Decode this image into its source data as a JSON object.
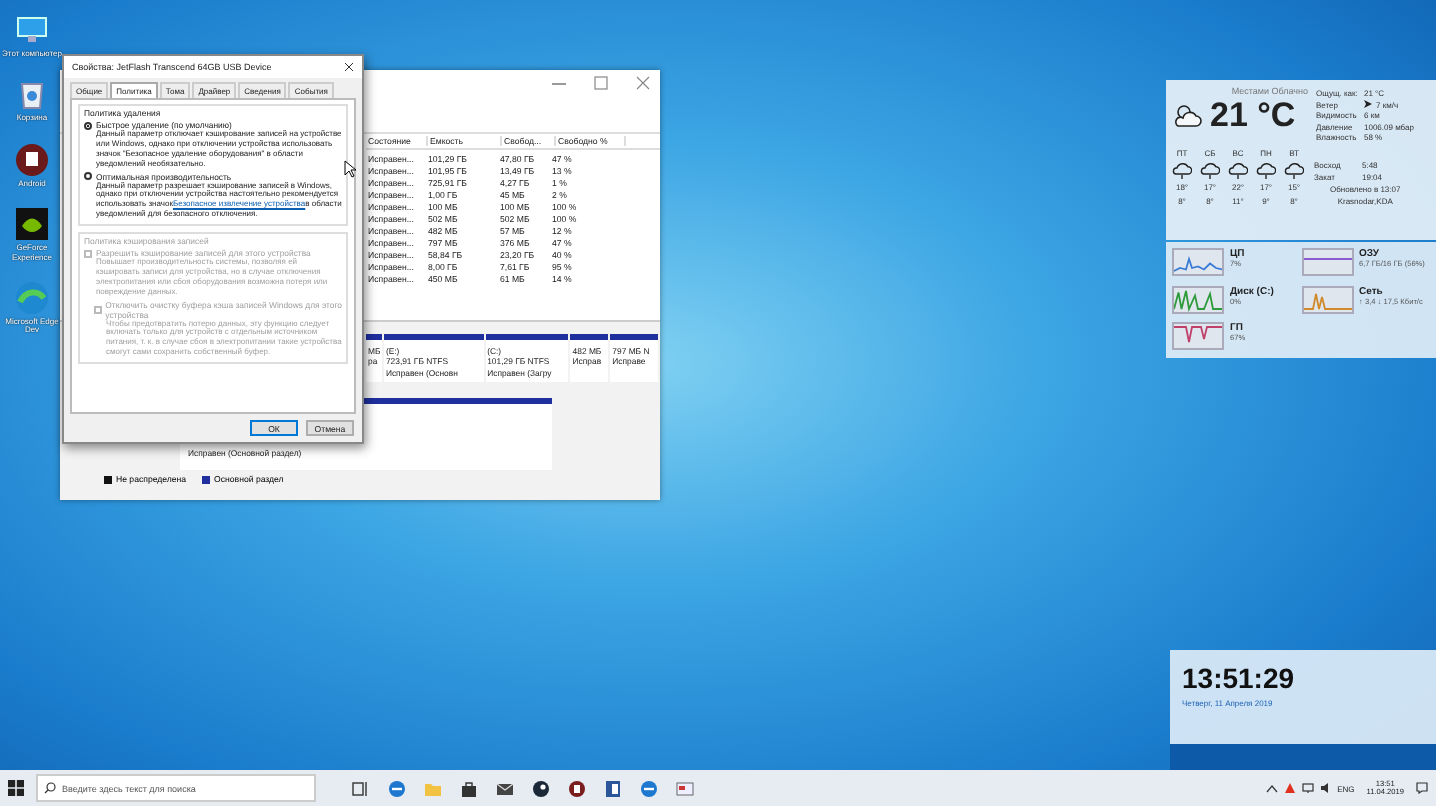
{
  "desktop_icons": [
    {
      "kind": "computer",
      "label": "Этот компьютер"
    },
    {
      "kind": "bin",
      "label": "Корзина"
    },
    {
      "kind": "app",
      "label": "Android"
    },
    {
      "kind": "gpu",
      "label": "GeForce Experience"
    },
    {
      "kind": "browser",
      "label": "Microsoft Edge Dev"
    }
  ],
  "disk_window": {
    "columns": [
      "Состояние",
      "Емкость",
      "Свобод...",
      "Свободно %"
    ],
    "rows": [
      [
        "Исправен...",
        "101,29 ГБ",
        "47,80 ГБ",
        "47 %"
      ],
      [
        "Исправен...",
        "101,95 ГБ",
        "13,49 ГБ",
        "13 %"
      ],
      [
        "Исправен...",
        "725,91 ГБ",
        "4,27 ГБ",
        "1 %"
      ],
      [
        "Исправен...",
        "1,00 ГБ",
        "45 МБ",
        "2 %"
      ],
      [
        "Исправен...",
        "100 МБ",
        "100 МБ",
        "100 %"
      ],
      [
        "Исправен...",
        "502 МБ",
        "502 МБ",
        "100 %"
      ],
      [
        "Исправен...",
        "482 МБ",
        "57 МБ",
        "12 %"
      ],
      [
        "Исправен...",
        "797 МБ",
        "376 МБ",
        "47 %"
      ],
      [
        "Исправен...",
        "58,84 ГБ",
        "23,20 ГБ",
        "40 %"
      ],
      [
        "Исправен...",
        "8,00 ГБ",
        "7,61 ГБ",
        "95 %"
      ],
      [
        "Исправен...",
        "450 МБ",
        "61 МБ",
        "14 %"
      ]
    ],
    "partitions": [
      {
        "lines": [
          "МБ",
          "ра"
        ]
      },
      {
        "lines": [
          "(E:)",
          "723,91 ГБ NTFS",
          "Исправен (Основн"
        ]
      },
      {
        "lines": [
          "(C:)",
          "101,29 ГБ NTFS",
          "Исправен (Загру"
        ]
      },
      {
        "lines": [
          "482 МБ",
          "Исправ"
        ]
      },
      {
        "lines": [
          "797 МБ N",
          "Исправе"
        ]
      }
    ],
    "second_disk_status": "Исправен (Основной раздел)",
    "legend": [
      {
        "label": "Не распределена",
        "color": "#111111"
      },
      {
        "label": "Основной раздел",
        "color": "#1f2f9e"
      }
    ]
  },
  "dialog": {
    "title": "Свойства: JetFlash Transcend 64GB USB Device",
    "tabs": [
      {
        "label": "Общие",
        "selected": false
      },
      {
        "label": "Политика",
        "selected": true
      },
      {
        "label": "Тома",
        "selected": false
      },
      {
        "label": "Драйвер",
        "selected": false
      },
      {
        "label": "Сведения",
        "selected": false
      },
      {
        "label": "События",
        "selected": false
      }
    ],
    "removal_policy": {
      "title": "Политика удаления",
      "options": [
        {
          "label": "Быстрое удаление (по умолчанию)",
          "selected": true,
          "description": "Данный параметр отключает кэширование записей на устройстве или Windows, однако при отключении устройства использовать значок \"Безопасное удаление оборудования\" в области уведомлений необязательно."
        },
        {
          "label": "Оптимальная производительность",
          "selected": false,
          "description": "Данный параметр разрешает кэширование записей в Windows, однако при отключении устройства настоятельно рекомендуется использовать значок",
          "link": "Безопасное извлечение устройства",
          "description_after": "в области уведомлений для безопасного отключения."
        }
      ]
    },
    "cache_policy": {
      "title": "Политика кэширования записей",
      "disabled": true,
      "options": [
        {
          "label": "Разрешить кэширование записей для этого устройства",
          "checked": false,
          "description": "Повышает производительность системы, позволяя ей кэшировать записи для устройства, но в случае отключения электропитания или сбоя оборудования возможна потеря или повреждение данных.",
          "children": [
            {
              "label": "Отключить очистку буфера кэша записей Windows для этого устройства",
              "checked": false,
              "description": "Чтобы предотвратить потерю данных, эту функцию следует включать только для устройств с отдельным источником питания, т. к. в случае сбоя в электропитании такие устройства смогут сами сохранить собственный буфер."
            }
          ]
        }
      ]
    },
    "buttons": [
      {
        "label": "ОК",
        "default": true
      },
      {
        "label": "Отмена",
        "default": false
      }
    ]
  },
  "weather": {
    "condition": "Местами Облачно",
    "temperature": "21 °C",
    "details": [
      {
        "kind": "text",
        "label": "Ощущ. как:",
        "value": "21 °C"
      },
      {
        "kind": "wind",
        "label": "Ветер",
        "value": "7 км/ч"
      },
      {
        "kind": "text",
        "label": "Видимость",
        "value": "6 км"
      },
      {
        "kind": "text",
        "label": "Давление",
        "value": "1006.09 мбар"
      },
      {
        "kind": "text",
        "label": "Влажность",
        "value": "58 %"
      }
    ],
    "forecast": [
      {
        "day": "ПТ",
        "high": "18°",
        "low": "8°"
      },
      {
        "day": "СБ",
        "high": "17°",
        "low": "8°"
      },
      {
        "day": "ВС",
        "high": "22°",
        "low": "11°"
      },
      {
        "day": "ПН",
        "high": "17°",
        "low": "9°"
      },
      {
        "day": "ВТ",
        "high": "15°",
        "low": "8°"
      }
    ],
    "sun": [
      {
        "label": "Восход",
        "value": "5:48"
      },
      {
        "label": "Закат",
        "value": "19:04"
      }
    ],
    "updated": "Обновлено в 13:07",
    "location": "Krasnodar,KDA"
  },
  "monitor": [
    {
      "label": "ЦП",
      "value": "7%"
    },
    {
      "label": "ОЗУ",
      "value": "6,7 ГБ/16 ГБ (56%)"
    },
    {
      "label": "Диск (C:)",
      "value": "0%"
    },
    {
      "label": "Сеть",
      "value": "↑ 3,4 ↓ 17,5 Кбит/с"
    },
    {
      "label": "ГП",
      "value": "67%"
    }
  ],
  "clock": {
    "time": "13:51:29",
    "date": "Четверг, 11 Апреля 2019"
  },
  "taskbar": {
    "search_placeholder": "Введите здесь текст для поиска",
    "apps": [
      {
        "kind": "taskview"
      },
      {
        "kind": "edge"
      },
      {
        "kind": "folder"
      },
      {
        "kind": "store"
      },
      {
        "kind": "mail"
      },
      {
        "kind": "steam"
      },
      {
        "kind": "app"
      },
      {
        "kind": "word"
      },
      {
        "kind": "edge"
      },
      {
        "kind": "window"
      }
    ],
    "language": "ENG",
    "time": "13:51",
    "date": "11.04.2019"
  }
}
